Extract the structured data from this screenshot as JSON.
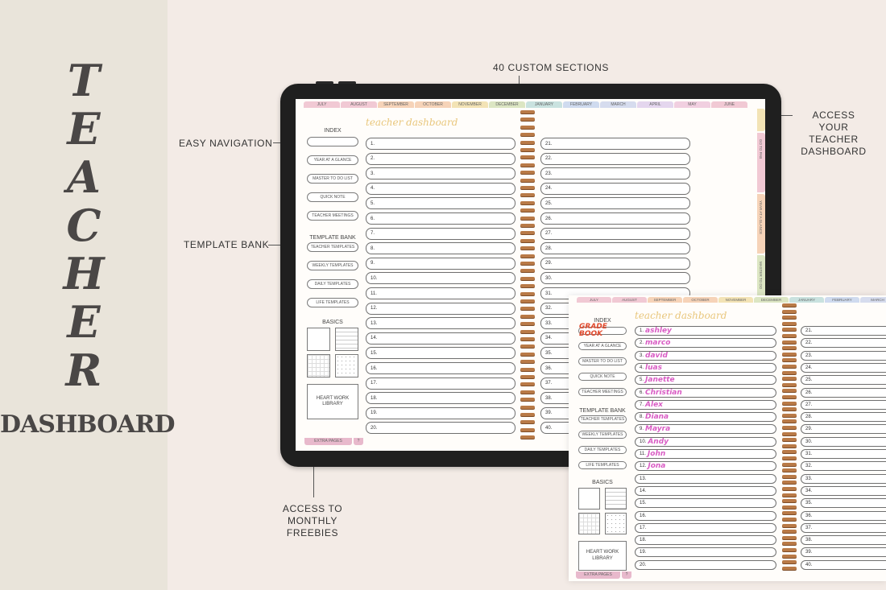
{
  "banner": {
    "title_letters": [
      "T",
      "E",
      "A",
      "C",
      "H",
      "E",
      "R"
    ],
    "subtitle": "DASHBOARD"
  },
  "callouts": {
    "custom_sections": "40 CUSTOM SECTIONS",
    "easy_navigation": "EASY NAVIGATION",
    "template_bank": "TEMPLATE BANK",
    "access_dashboard_1": "ACCESS YOUR",
    "access_dashboard_2": "TEACHER",
    "access_dashboard_3": "DASHBOARD",
    "freebies_1": "ACCESS TO",
    "freebies_2": "MONTHLY FREEBIES"
  },
  "planner": {
    "months": [
      "JULY",
      "AUGUST",
      "SEPTEMBER",
      "OCTOBER",
      "NOVEMBER",
      "DECEMBER",
      "JANUARY",
      "FEBRUARY",
      "MARCH",
      "APRIL",
      "MAY",
      "JUNE"
    ],
    "month_colors": [
      "#f1c9d4",
      "#f1c9d4",
      "#f6d3b8",
      "#f6d3b8",
      "#f3e3b5",
      "#dce6c3",
      "#c9e2df",
      "#cfdbef",
      "#d6dcee",
      "#e4d6ee",
      "#f1cfe0",
      "#f1c9d4"
    ],
    "title": "teacher dashboard",
    "index_title": "INDEX",
    "index_items": [
      "YEAR AT A GLANCE",
      "MASTER TO DO LIST",
      "QUICK NOTE",
      "TEACHER MEETINGS"
    ],
    "first_index_item_filled": "grade book",
    "template_bank_title": "TEMPLATE BANK",
    "template_items": [
      "TEACHER TEMPLATES",
      "WEEKLY TEMPLATES",
      "DAILY TEMPLATES",
      "LIFE TEMPLATES"
    ],
    "basics_title": "BASICS",
    "library_1": "HEART WORK",
    "library_2": "LIBRARY",
    "extra_pages": "EXTRA PAGES",
    "extra_q": "?",
    "side_tabs": [
      "GO TO PAB",
      "YEAR AT A GLANCE",
      "MASTER TO DO"
    ],
    "filled_names": [
      "ashley",
      "marco",
      "david",
      "luas",
      "Janette",
      "Christian",
      "Alex",
      "Diana",
      "Mayra",
      "Andy",
      "John",
      "Jona"
    ]
  }
}
